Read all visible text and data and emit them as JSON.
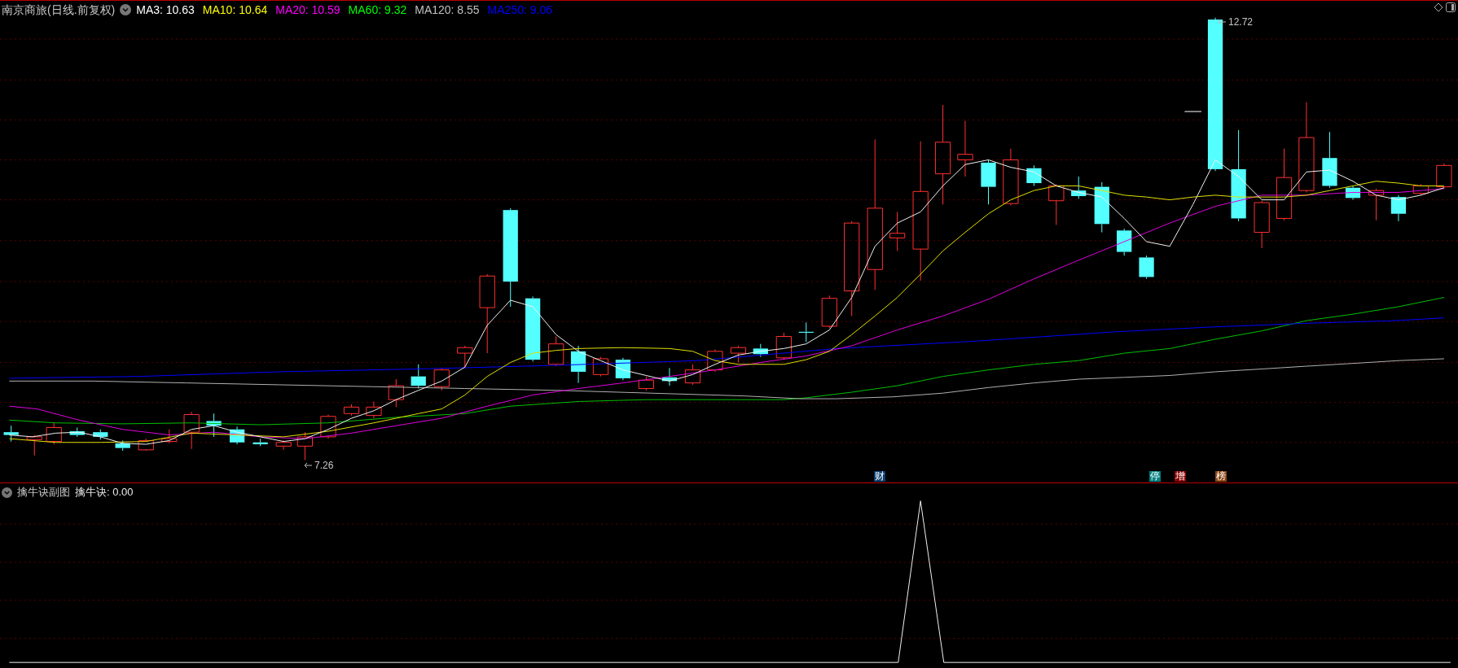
{
  "main_chart": {
    "title": "南京商旅(日线.前复权)",
    "indicators": [
      {
        "label": "MA3: 10.63",
        "color": "#ffffff"
      },
      {
        "label": "MA10: 10.64",
        "color": "#ffff00"
      },
      {
        "label": "MA20: 10.59",
        "color": "#ff00ff"
      },
      {
        "label": "MA60: 9.32",
        "color": "#00ff00"
      },
      {
        "label": "MA120: 8.55",
        "color": "#c0c0c0"
      },
      {
        "label": "MA250: 9.06",
        "color": "#0000ff"
      }
    ],
    "high_label": "12.72",
    "low_label": "7.26",
    "event_markers": [
      {
        "label": "财",
        "color": "#0b3d6e"
      },
      {
        "label": "停",
        "color": "#008080"
      },
      {
        "label": "增",
        "color": "#8b0000"
      },
      {
        "label": "榜",
        "color": "#8b4513"
      }
    ]
  },
  "sub_chart": {
    "title": "擒牛诀副图",
    "indicator": "擒牛诀: 0.00"
  }
}
